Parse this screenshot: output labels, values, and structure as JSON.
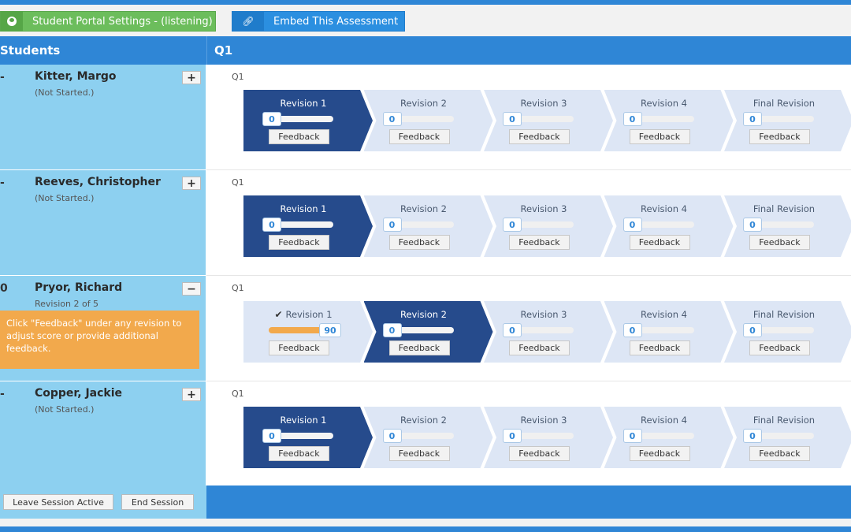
{
  "toolbar": {
    "portal_label": "Student Portal Settings - (listening)",
    "embed_label": "Embed This Assessment"
  },
  "header": {
    "students_label": "Students",
    "question_label": "Q1"
  },
  "icons": {
    "portal": "user-circle-icon",
    "embed": "link-icon"
  },
  "colors": {
    "primary": "#2f86d6",
    "success": "#6cbd5c",
    "active_revision": "#264b8c",
    "inactive_revision": "#dde6f5",
    "student_panel": "#8dd0f0",
    "tip": "#f2a94c"
  },
  "students": [
    {
      "prefix": "-",
      "name": "Kitter, Margo",
      "status": "(Not Started.)",
      "toggle": "+",
      "question": "Q1",
      "revisions": [
        {
          "title": "Revision 1",
          "score": "0",
          "progress": 0,
          "feedback": "Feedback"
        },
        {
          "title": "Revision 2",
          "score": "0",
          "progress": 0,
          "feedback": "Feedback"
        },
        {
          "title": "Revision 3",
          "score": "0",
          "progress": 0,
          "feedback": "Feedback"
        },
        {
          "title": "Revision 4",
          "score": "0",
          "progress": 0,
          "feedback": "Feedback"
        },
        {
          "title": "Final Revision",
          "score": "0",
          "progress": 0,
          "feedback": "Feedback"
        }
      ],
      "active_revision": 0
    },
    {
      "prefix": "-",
      "name": "Reeves, Christopher",
      "status": "(Not Started.)",
      "toggle": "+",
      "question": "Q1",
      "revisions": [
        {
          "title": "Revision 1",
          "score": "0",
          "progress": 0,
          "feedback": "Feedback"
        },
        {
          "title": "Revision 2",
          "score": "0",
          "progress": 0,
          "feedback": "Feedback"
        },
        {
          "title": "Revision 3",
          "score": "0",
          "progress": 0,
          "feedback": "Feedback"
        },
        {
          "title": "Revision 4",
          "score": "0",
          "progress": 0,
          "feedback": "Feedback"
        },
        {
          "title": "Final Revision",
          "score": "0",
          "progress": 0,
          "feedback": "Feedback"
        }
      ],
      "active_revision": 0
    },
    {
      "prefix": "0",
      "name": "Pryor, Richard",
      "status": "Revision 2 of 5",
      "toggle": "−",
      "tip": "Click \"Feedback\" under any revision to adjust score or provide additional feedback.",
      "question": "Q1",
      "revisions": [
        {
          "title": "Revision 1",
          "score": "90",
          "progress": 0.9,
          "feedback": "Feedback",
          "checked": true
        },
        {
          "title": "Revision 2",
          "score": "0",
          "progress": 0,
          "feedback": "Feedback"
        },
        {
          "title": "Revision 3",
          "score": "0",
          "progress": 0,
          "feedback": "Feedback"
        },
        {
          "title": "Revision 4",
          "score": "0",
          "progress": 0,
          "feedback": "Feedback"
        },
        {
          "title": "Final Revision",
          "score": "0",
          "progress": 0,
          "feedback": "Feedback"
        }
      ],
      "active_revision": 1
    },
    {
      "prefix": "-",
      "name": "Copper, Jackie",
      "status": "(Not Started.)",
      "toggle": "+",
      "question": "Q1",
      "revisions": [
        {
          "title": "Revision 1",
          "score": "0",
          "progress": 0,
          "feedback": "Feedback"
        },
        {
          "title": "Revision 2",
          "score": "0",
          "progress": 0,
          "feedback": "Feedback"
        },
        {
          "title": "Revision 3",
          "score": "0",
          "progress": 0,
          "feedback": "Feedback"
        },
        {
          "title": "Revision 4",
          "score": "0",
          "progress": 0,
          "feedback": "Feedback"
        },
        {
          "title": "Final Revision",
          "score": "0",
          "progress": 0,
          "feedback": "Feedback"
        }
      ],
      "active_revision": 0
    }
  ],
  "footer": {
    "leave_label": "Leave Session Active",
    "end_label": "End Session"
  }
}
